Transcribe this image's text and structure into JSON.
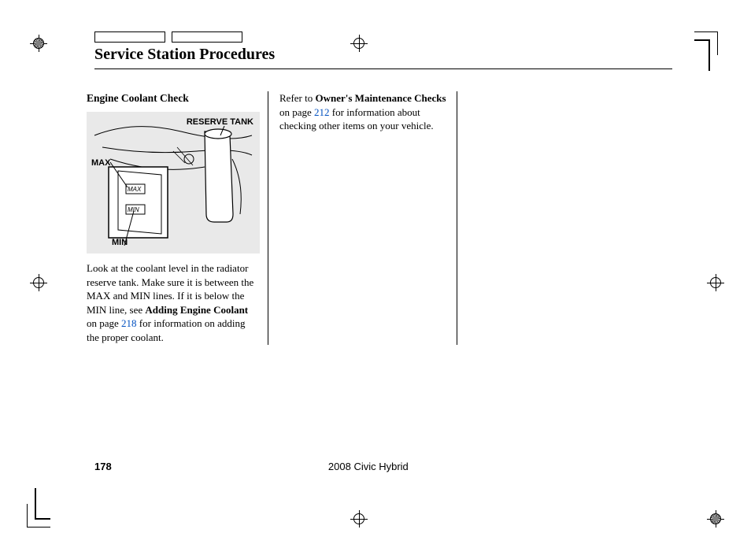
{
  "page": {
    "title": "Service Station Procedures",
    "number": "178",
    "vehicle": "2008  Civic  Hybrid"
  },
  "diagram": {
    "reserve_tank": "RESERVE TANK",
    "max": "MAX",
    "min": "MIN"
  },
  "col1": {
    "heading": "Engine Coolant Check",
    "body_pre": "Look at the coolant level in the radiator reserve tank. Make sure it is between the MAX and MIN lines. If it is below the MIN line, see ",
    "bold1": "Adding Engine Coolant",
    "body_mid": " on page ",
    "link1": "218",
    "body_post": " for information on adding the proper coolant."
  },
  "col2": {
    "pre": "Refer to ",
    "bold1": "Owner's Maintenance Checks",
    "mid": " on page ",
    "link1": "212",
    "post": " for information about checking other items on your vehicle."
  }
}
